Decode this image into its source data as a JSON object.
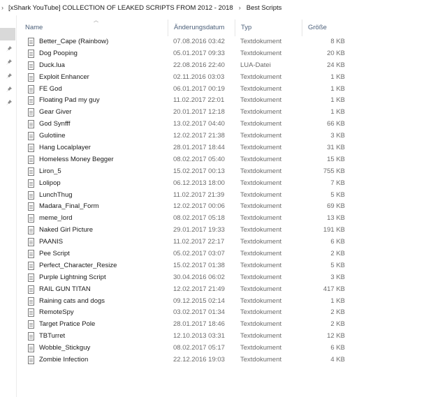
{
  "breadcrumb": {
    "segments": [
      "[xShark YouTube] COLLECTION OF LEAKED SCRIPTS FROM 2012 - 2018",
      "Best Scripts"
    ]
  },
  "columns": {
    "name": "Name",
    "date": "Änderungsdatum",
    "type": "Typ",
    "size": "Größe"
  },
  "sorted_column": "name",
  "files": [
    {
      "name": "Better_Cape (Rainbow)",
      "date": "07.08.2016 03:42",
      "type": "Textdokument",
      "size": "8 KB"
    },
    {
      "name": "Dog Pooping",
      "date": "05.01.2017 09:33",
      "type": "Textdokument",
      "size": "20 KB"
    },
    {
      "name": "Duck.lua",
      "date": "22.08.2016 22:40",
      "type": "LUA-Datei",
      "size": "24 KB"
    },
    {
      "name": "Exploit Enhancer",
      "date": "02.11.2016 03:03",
      "type": "Textdokument",
      "size": "1 KB"
    },
    {
      "name": "FE God",
      "date": "06.01.2017 00:19",
      "type": "Textdokument",
      "size": "1 KB"
    },
    {
      "name": "Floating Pad my guy",
      "date": "11.02.2017 22:01",
      "type": "Textdokument",
      "size": "1 KB"
    },
    {
      "name": "Gear Giver",
      "date": "20.01.2017 12:18",
      "type": "Textdokument",
      "size": "1 KB"
    },
    {
      "name": "God Synfff",
      "date": "13.02.2017 04:40",
      "type": "Textdokument",
      "size": "66 KB"
    },
    {
      "name": "Gulotiine",
      "date": "12.02.2017 21:38",
      "type": "Textdokument",
      "size": "3 KB"
    },
    {
      "name": "Hang Localplayer",
      "date": "28.01.2017 18:44",
      "type": "Textdokument",
      "size": "31 KB"
    },
    {
      "name": "Homeless Money Begger",
      "date": "08.02.2017 05:40",
      "type": "Textdokument",
      "size": "15 KB"
    },
    {
      "name": "Liron_5",
      "date": "15.02.2017 00:13",
      "type": "Textdokument",
      "size": "755 KB"
    },
    {
      "name": "Lolipop",
      "date": "06.12.2013 18:00",
      "type": "Textdokument",
      "size": "7 KB"
    },
    {
      "name": "LunchThug",
      "date": "11.02.2017 21:39",
      "type": "Textdokument",
      "size": "5 KB"
    },
    {
      "name": "Madara_Final_Form",
      "date": "12.02.2017 00:06",
      "type": "Textdokument",
      "size": "69 KB"
    },
    {
      "name": "meme_lord",
      "date": "08.02.2017 05:18",
      "type": "Textdokument",
      "size": "13 KB"
    },
    {
      "name": "Naked Girl Picture",
      "date": "29.01.2017 19:33",
      "type": "Textdokument",
      "size": "191 KB"
    },
    {
      "name": "PAANIS",
      "date": "11.02.2017 22:17",
      "type": "Textdokument",
      "size": "6 KB"
    },
    {
      "name": "Pee Script",
      "date": "05.02.2017 03:07",
      "type": "Textdokument",
      "size": "2 KB"
    },
    {
      "name": "Perfect_Character_Resize",
      "date": "15.02.2017 01:38",
      "type": "Textdokument",
      "size": "5 KB"
    },
    {
      "name": "Purple Lightning Script",
      "date": "30.04.2016 06:02",
      "type": "Textdokument",
      "size": "3 KB"
    },
    {
      "name": "RAIL GUN TITAN",
      "date": "12.02.2017 21:49",
      "type": "Textdokument",
      "size": "417 KB"
    },
    {
      "name": "Raining cats and dogs",
      "date": "09.12.2015 02:14",
      "type": "Textdokument",
      "size": "1 KB"
    },
    {
      "name": "RemoteSpy",
      "date": "03.02.2017 01:34",
      "type": "Textdokument",
      "size": "2 KB"
    },
    {
      "name": "Target Pratice Pole",
      "date": "28.01.2017 18:46",
      "type": "Textdokument",
      "size": "2 KB"
    },
    {
      "name": "TBTurret",
      "date": "12.10.2013 03:31",
      "type": "Textdokument",
      "size": "12 KB"
    },
    {
      "name": "Wobble_Stickguy",
      "date": "08.02.2017 05:17",
      "type": "Textdokument",
      "size": "6 KB"
    },
    {
      "name": "Zombie Infection",
      "date": "22.12.2016 19:03",
      "type": "Textdokument",
      "size": "4 KB"
    }
  ],
  "icons": {
    "file": "text-document-icon",
    "pin": "pin-icon",
    "sort": "sort-ascending-icon"
  },
  "colors": {
    "header_text": "#4c607a",
    "detail_text": "#6b6b6b",
    "nav_selected": "#d9d9d9"
  }
}
